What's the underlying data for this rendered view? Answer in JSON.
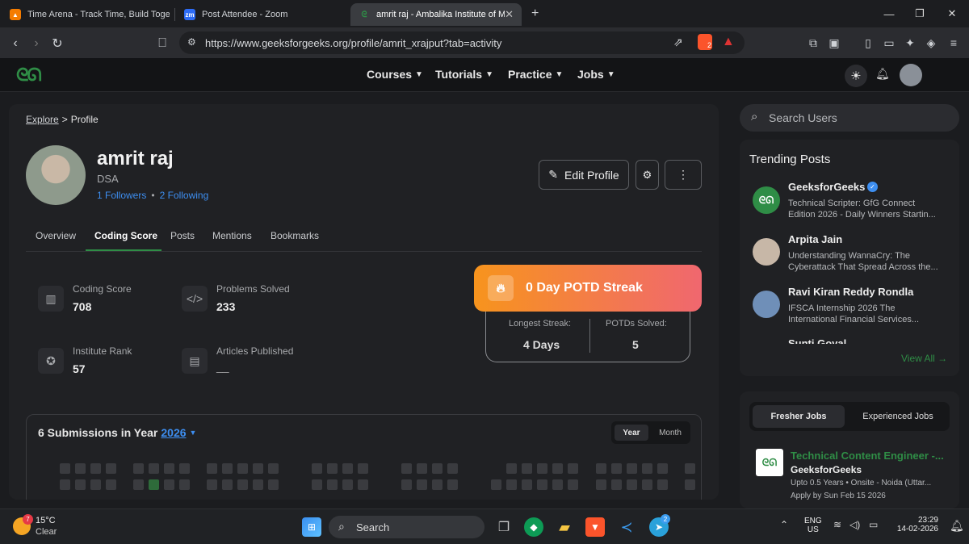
{
  "browser": {
    "tabs": [
      {
        "title": "Time Arena - Track Time, Build Togeth",
        "icon": "flame-favicon-icon"
      },
      {
        "title": "Post Attendee - Zoom",
        "icon": "zoom-favicon-icon",
        "badge": "zm"
      },
      {
        "title": "amrit raj - Ambalika Institute of M",
        "icon": "gfg-favicon-icon",
        "active": true
      }
    ],
    "new_tab": "+",
    "url": "https://www.geeksforgeeks.org/profile/amrit_xrajput?tab=activity",
    "brave_badge": "2"
  },
  "site": {
    "logo": "GfG",
    "nav": [
      "Courses",
      "Tutorials",
      "Practice",
      "Jobs"
    ]
  },
  "profile": {
    "breadcrumb_explore": "Explore",
    "breadcrumb_sep": ">",
    "breadcrumb_current": "Profile",
    "name": "amrit raj",
    "subtitle": "DSA",
    "followers": "1 Followers",
    "dot": "•",
    "following": "2 Following",
    "edit_button": "Edit Profile",
    "tabs": [
      "Overview",
      "Coding Score",
      "Posts",
      "Mentions",
      "Bookmarks"
    ],
    "active_tab": "Coding Score",
    "stats": {
      "coding_score_label": "Coding Score",
      "coding_score": "708",
      "problems_label": "Problems Solved",
      "problems": "233",
      "rank_label": "Institute Rank",
      "rank": "57",
      "articles_label": "Articles Published",
      "articles": "__"
    },
    "potd": {
      "title": "0 Day POTD Streak",
      "longest_label": "Longest Streak:",
      "longest": "4 Days",
      "solved_label": "POTDs Solved:",
      "solved": "5"
    },
    "submissions": {
      "prefix": "6 Submissions in Year",
      "year": "2026",
      "toggle": [
        "Year",
        "Month"
      ],
      "active_toggle": "Year"
    }
  },
  "sidebar": {
    "search_placeholder": "Search Users",
    "trending_title": "Trending Posts",
    "posts": [
      {
        "author": "GeeksforGeeks",
        "verified": true,
        "line1": "Technical Scripter: GfG Connect",
        "line2": "Edition 2026 - Daily Winners Startin..."
      },
      {
        "author": "Arpita Jain",
        "line1": "Understanding WannaCry: The",
        "line2": "Cyberattack That Spread Across the..."
      },
      {
        "author": "Ravi Kiran Reddy Rondla",
        "line1": "IFSCA Internship 2026 The",
        "line2": "International Financial Services..."
      },
      {
        "author": "Sunti Goyal"
      }
    ],
    "view_all": "View All →",
    "jobs_tabs": [
      "Fresher Jobs",
      "Experienced Jobs"
    ],
    "job": {
      "title": "Technical Content Engineer -...",
      "company": "GeeksforGeeks",
      "meta": "Upto 0.5 Years • Onsite - Noida (Uttar...",
      "apply": "Apply by Sun Feb 15 2026"
    }
  },
  "taskbar": {
    "weather_temp": "15°C",
    "weather_desc": "Clear",
    "weather_badge": "7",
    "search": "Search",
    "lang1": "ENG",
    "lang2": "US",
    "time": "23:29",
    "date": "14-02-2026",
    "telegram_badge": "2"
  },
  "colors": {
    "accent_green": "#2f8d46",
    "link_blue": "#3d8ef0",
    "potd_start": "#f7941d",
    "potd_end": "#f0676f"
  }
}
